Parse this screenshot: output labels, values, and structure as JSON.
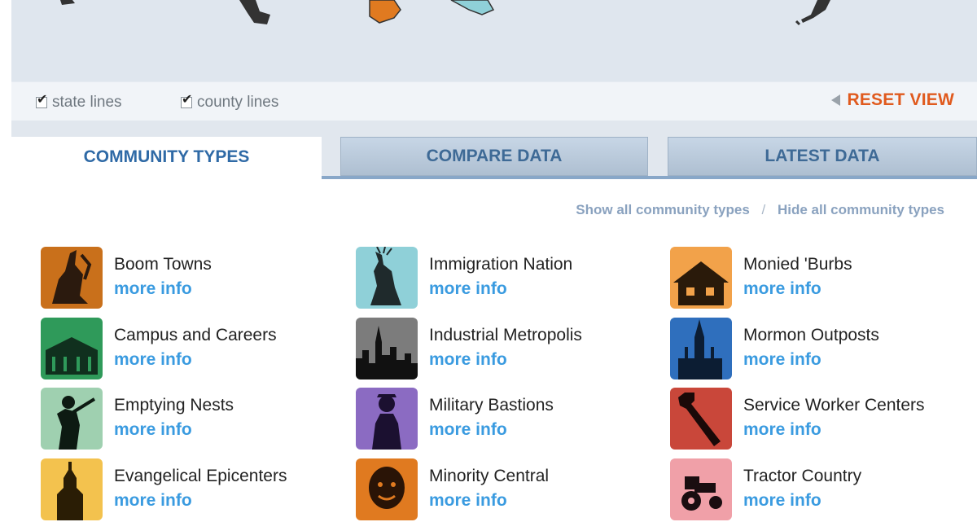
{
  "map": {
    "toggles": [
      {
        "label": "state lines",
        "checked": true
      },
      {
        "label": "county lines",
        "checked": true
      }
    ],
    "reset_label": "RESET VIEW"
  },
  "tabs": [
    {
      "label": "COMMUNITY TYPES",
      "active": true
    },
    {
      "label": "COMPARE DATA",
      "active": false
    },
    {
      "label": "LATEST DATA",
      "active": false
    }
  ],
  "links": {
    "show_all": "Show all community types",
    "separator": "/",
    "hide_all": "Hide all community types"
  },
  "community_types": [
    {
      "name": "Boom Towns",
      "more": "more info",
      "color": "#c9701b",
      "icon": "construction-icon"
    },
    {
      "name": "Immigration Nation",
      "more": "more info",
      "color": "#8fd0d8",
      "icon": "statue-of-liberty-icon"
    },
    {
      "name": "Monied 'Burbs",
      "more": "more info",
      "color": "#f2a24a",
      "icon": "house-icon"
    },
    {
      "name": "Campus and Careers",
      "more": "more info",
      "color": "#2f9a5a",
      "icon": "campus-icon"
    },
    {
      "name": "Industrial Metropolis",
      "more": "more info",
      "color": "#7c7c7c",
      "icon": "skyline-icon"
    },
    {
      "name": "Mormon Outposts",
      "more": "more info",
      "color": "#2f6fbd",
      "icon": "temple-icon"
    },
    {
      "name": "Emptying Nests",
      "more": "more info",
      "color": "#9fd0b0",
      "icon": "golfer-icon"
    },
    {
      "name": "Military Bastions",
      "more": "more info",
      "color": "#8b6bc2",
      "icon": "soldier-icon"
    },
    {
      "name": "Service Worker Centers",
      "more": "more info",
      "color": "#c9473a",
      "icon": "wrench-icon"
    },
    {
      "name": "Evangelical Epicenters",
      "more": "more info",
      "color": "#f3c24e",
      "icon": "church-icon"
    },
    {
      "name": "Minority Central",
      "more": "more info",
      "color": "#e07a20",
      "icon": "face-icon"
    },
    {
      "name": "Tractor Country",
      "more": "more info",
      "color": "#f0a0a8",
      "icon": "tractor-icon"
    }
  ],
  "colors": {
    "accent_link": "#3a9be0",
    "tab_text": "#3a6fa8",
    "reset": "#e05a1e"
  }
}
